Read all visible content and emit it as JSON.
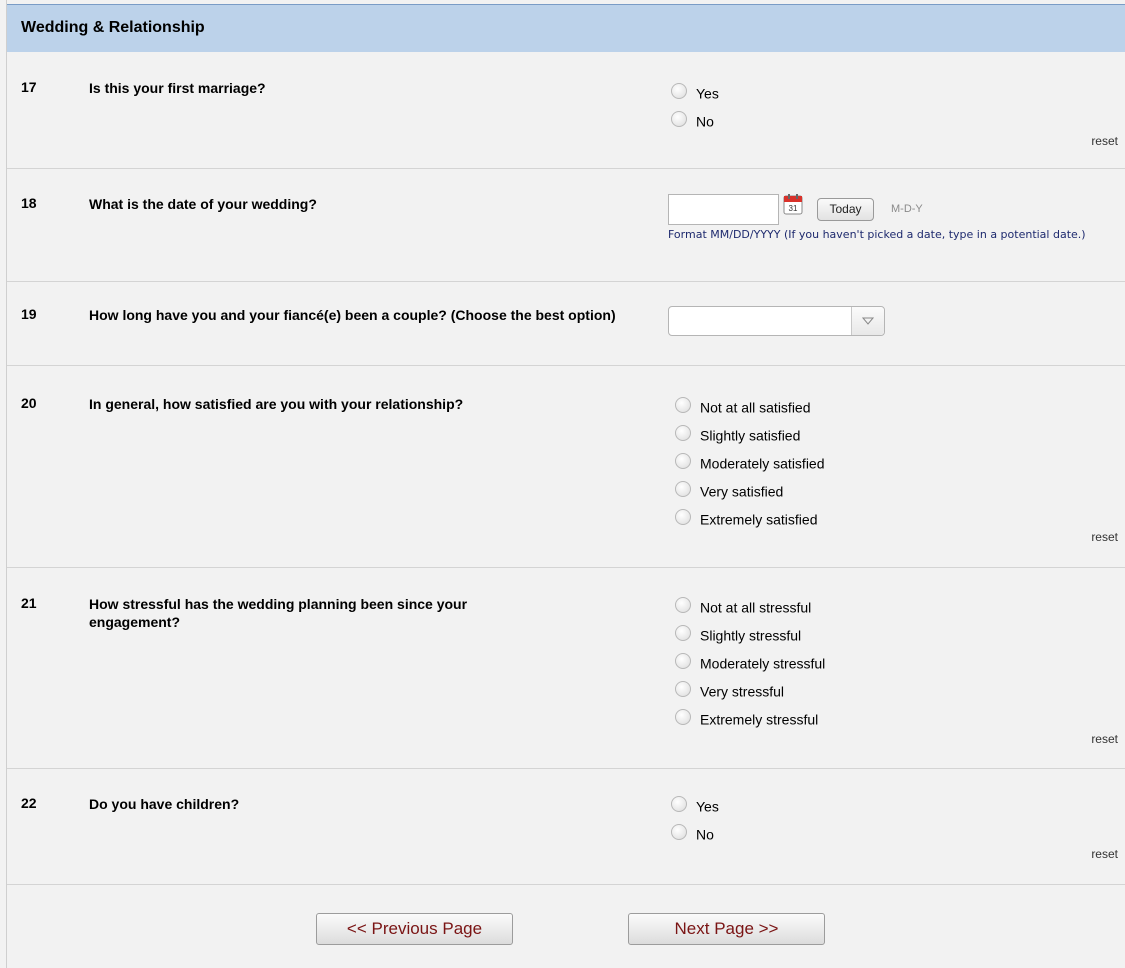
{
  "section": {
    "title": "Wedding & Relationship"
  },
  "questions": [
    {
      "num": "17",
      "text": "Is this your first marriage?",
      "options": [
        "Yes",
        "No"
      ],
      "reset": "reset"
    },
    {
      "num": "18",
      "text": "What is the date of your wedding?",
      "date_value": "",
      "today_label": "Today",
      "date_format_hint": "M-D-Y",
      "format_note": "Format MM/DD/YYYY (If you haven't picked a date, type in a potential date.)"
    },
    {
      "num": "19",
      "text": "How long have you and your fiancé(e) been a couple? (Choose the best option)",
      "select_value": ""
    },
    {
      "num": "20",
      "text": "In general, how satisfied are you with your relationship?",
      "options": [
        "Not at all satisfied",
        "Slightly satisfied",
        "Moderately satisfied",
        "Very satisfied",
        "Extremely satisfied"
      ],
      "reset": "reset"
    },
    {
      "num": "21",
      "text": "How stressful has the wedding planning been since your engagement?",
      "options": [
        "Not at all stressful",
        "Slightly stressful",
        "Moderately stressful",
        "Very stressful",
        "Extremely stressful"
      ],
      "reset": "reset"
    },
    {
      "num": "22",
      "text": "Do you have children?",
      "options": [
        "Yes",
        "No"
      ],
      "reset": "reset"
    }
  ],
  "navigation": {
    "previous_label": "<< Previous Page",
    "next_label": "Next Page >>"
  },
  "colors": {
    "header_bg": "#bcd2ea",
    "page_bg": "#f2f2f2",
    "nav_text": "#7a1414",
    "note_text": "#1e2a6e"
  }
}
